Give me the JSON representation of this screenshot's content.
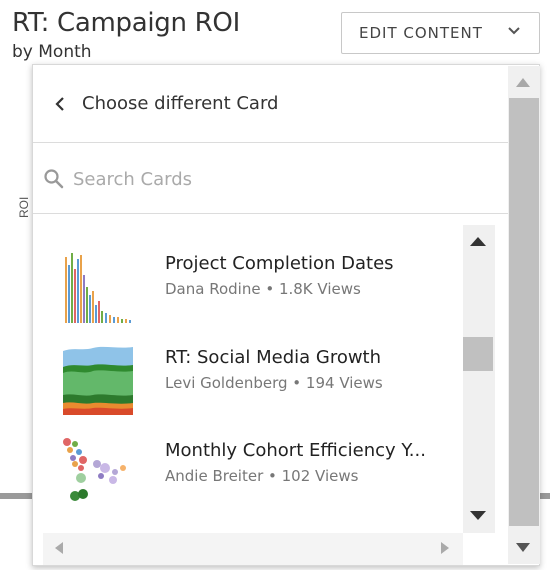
{
  "card": {
    "title": "RT: Campaign ROI",
    "subtitle": "by Month",
    "axis_label": "ROI"
  },
  "edit_button": {
    "label": "EDIT CONTENT",
    "icon": "chevron-down-icon"
  },
  "panel": {
    "back_label": "Choose different Card",
    "back_icon": "chevron-left-icon",
    "search": {
      "placeholder": "Search Cards",
      "value": "",
      "icon": "search-icon"
    },
    "items": [
      {
        "name": "Project Completion Dates",
        "author": "Dana Rodine",
        "views": "1.8K Views",
        "meta": "Dana Rodine • 1.8K Views",
        "thumb": "bar-chart-thumbnail"
      },
      {
        "name": "RT: Social Media Growth",
        "author": "Levi Goldenberg",
        "views": "194 Views",
        "meta": "Levi Goldenberg • 194 Views",
        "thumb": "stacked-area-thumbnail"
      },
      {
        "name": "Monthly Cohort Efficiency Y...",
        "author": "Andie Breiter",
        "views": "102 Views",
        "meta": "Andie Breiter • 102 Views",
        "thumb": "bubble-chart-thumbnail"
      }
    ]
  },
  "colors": {
    "accent_green": "#3a9a3a",
    "border": "#dcdcdc",
    "scrollbar_thumb": "#c0c0c0"
  }
}
